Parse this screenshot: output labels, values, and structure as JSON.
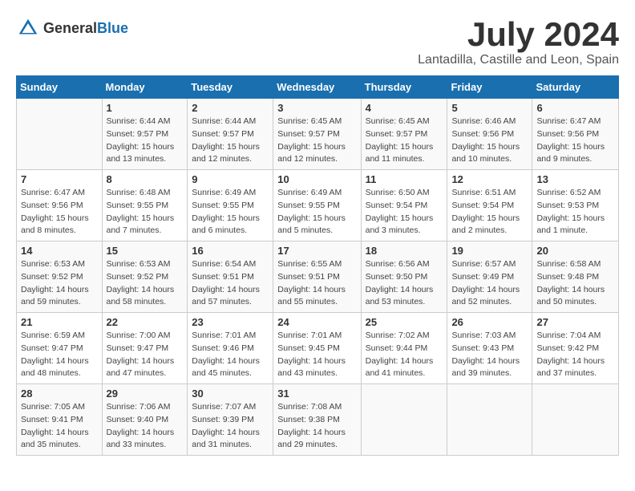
{
  "header": {
    "logo_general": "General",
    "logo_blue": "Blue",
    "title": "July 2024",
    "location": "Lantadilla, Castille and Leon, Spain"
  },
  "days_of_week": [
    "Sunday",
    "Monday",
    "Tuesday",
    "Wednesday",
    "Thursday",
    "Friday",
    "Saturday"
  ],
  "weeks": [
    [
      {
        "day": "",
        "info": ""
      },
      {
        "day": "1",
        "info": "Sunrise: 6:44 AM\nSunset: 9:57 PM\nDaylight: 15 hours\nand 13 minutes."
      },
      {
        "day": "2",
        "info": "Sunrise: 6:44 AM\nSunset: 9:57 PM\nDaylight: 15 hours\nand 12 minutes."
      },
      {
        "day": "3",
        "info": "Sunrise: 6:45 AM\nSunset: 9:57 PM\nDaylight: 15 hours\nand 12 minutes."
      },
      {
        "day": "4",
        "info": "Sunrise: 6:45 AM\nSunset: 9:57 PM\nDaylight: 15 hours\nand 11 minutes."
      },
      {
        "day": "5",
        "info": "Sunrise: 6:46 AM\nSunset: 9:56 PM\nDaylight: 15 hours\nand 10 minutes."
      },
      {
        "day": "6",
        "info": "Sunrise: 6:47 AM\nSunset: 9:56 PM\nDaylight: 15 hours\nand 9 minutes."
      }
    ],
    [
      {
        "day": "7",
        "info": "Sunrise: 6:47 AM\nSunset: 9:56 PM\nDaylight: 15 hours\nand 8 minutes."
      },
      {
        "day": "8",
        "info": "Sunrise: 6:48 AM\nSunset: 9:55 PM\nDaylight: 15 hours\nand 7 minutes."
      },
      {
        "day": "9",
        "info": "Sunrise: 6:49 AM\nSunset: 9:55 PM\nDaylight: 15 hours\nand 6 minutes."
      },
      {
        "day": "10",
        "info": "Sunrise: 6:49 AM\nSunset: 9:55 PM\nDaylight: 15 hours\nand 5 minutes."
      },
      {
        "day": "11",
        "info": "Sunrise: 6:50 AM\nSunset: 9:54 PM\nDaylight: 15 hours\nand 3 minutes."
      },
      {
        "day": "12",
        "info": "Sunrise: 6:51 AM\nSunset: 9:54 PM\nDaylight: 15 hours\nand 2 minutes."
      },
      {
        "day": "13",
        "info": "Sunrise: 6:52 AM\nSunset: 9:53 PM\nDaylight: 15 hours\nand 1 minute."
      }
    ],
    [
      {
        "day": "14",
        "info": "Sunrise: 6:53 AM\nSunset: 9:52 PM\nDaylight: 14 hours\nand 59 minutes."
      },
      {
        "day": "15",
        "info": "Sunrise: 6:53 AM\nSunset: 9:52 PM\nDaylight: 14 hours\nand 58 minutes."
      },
      {
        "day": "16",
        "info": "Sunrise: 6:54 AM\nSunset: 9:51 PM\nDaylight: 14 hours\nand 57 minutes."
      },
      {
        "day": "17",
        "info": "Sunrise: 6:55 AM\nSunset: 9:51 PM\nDaylight: 14 hours\nand 55 minutes."
      },
      {
        "day": "18",
        "info": "Sunrise: 6:56 AM\nSunset: 9:50 PM\nDaylight: 14 hours\nand 53 minutes."
      },
      {
        "day": "19",
        "info": "Sunrise: 6:57 AM\nSunset: 9:49 PM\nDaylight: 14 hours\nand 52 minutes."
      },
      {
        "day": "20",
        "info": "Sunrise: 6:58 AM\nSunset: 9:48 PM\nDaylight: 14 hours\nand 50 minutes."
      }
    ],
    [
      {
        "day": "21",
        "info": "Sunrise: 6:59 AM\nSunset: 9:47 PM\nDaylight: 14 hours\nand 48 minutes."
      },
      {
        "day": "22",
        "info": "Sunrise: 7:00 AM\nSunset: 9:47 PM\nDaylight: 14 hours\nand 47 minutes."
      },
      {
        "day": "23",
        "info": "Sunrise: 7:01 AM\nSunset: 9:46 PM\nDaylight: 14 hours\nand 45 minutes."
      },
      {
        "day": "24",
        "info": "Sunrise: 7:01 AM\nSunset: 9:45 PM\nDaylight: 14 hours\nand 43 minutes."
      },
      {
        "day": "25",
        "info": "Sunrise: 7:02 AM\nSunset: 9:44 PM\nDaylight: 14 hours\nand 41 minutes."
      },
      {
        "day": "26",
        "info": "Sunrise: 7:03 AM\nSunset: 9:43 PM\nDaylight: 14 hours\nand 39 minutes."
      },
      {
        "day": "27",
        "info": "Sunrise: 7:04 AM\nSunset: 9:42 PM\nDaylight: 14 hours\nand 37 minutes."
      }
    ],
    [
      {
        "day": "28",
        "info": "Sunrise: 7:05 AM\nSunset: 9:41 PM\nDaylight: 14 hours\nand 35 minutes."
      },
      {
        "day": "29",
        "info": "Sunrise: 7:06 AM\nSunset: 9:40 PM\nDaylight: 14 hours\nand 33 minutes."
      },
      {
        "day": "30",
        "info": "Sunrise: 7:07 AM\nSunset: 9:39 PM\nDaylight: 14 hours\nand 31 minutes."
      },
      {
        "day": "31",
        "info": "Sunrise: 7:08 AM\nSunset: 9:38 PM\nDaylight: 14 hours\nand 29 minutes."
      },
      {
        "day": "",
        "info": ""
      },
      {
        "day": "",
        "info": ""
      },
      {
        "day": "",
        "info": ""
      }
    ]
  ]
}
